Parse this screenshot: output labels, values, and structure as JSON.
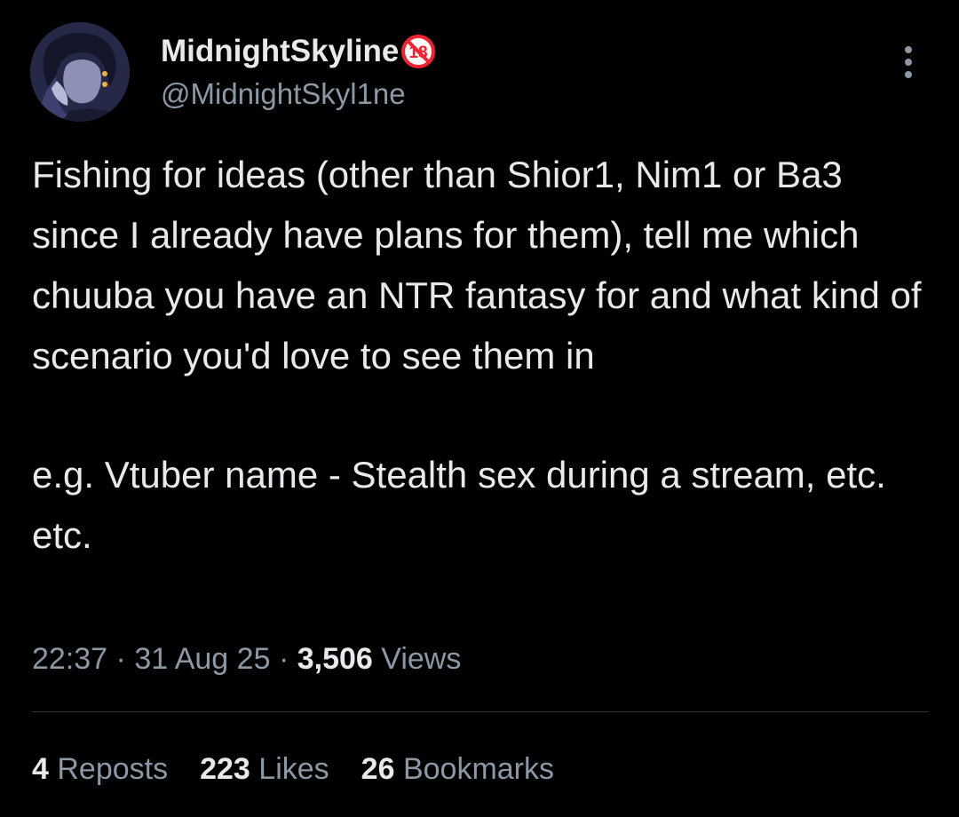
{
  "author": {
    "display_name": "MidnightSkyline",
    "handle": "@MidnightSkyl1ne",
    "badge_icon": "age-restricted-18-icon",
    "badge_text": "18"
  },
  "tweet": {
    "paragraph_1": "Fishing for ideas (other than Shior1, Nim1 or Ba3 since I already have plans for them), tell me which chuuba you have an NTR fantasy for and what kind of scenario you'd love to see them in",
    "paragraph_2": "e.g. Vtuber name - Stealth sex during a stream, etc. etc."
  },
  "meta": {
    "time": "22:37",
    "separator": "·",
    "date": "31 Aug 25",
    "views_count": "3,506",
    "views_label": "Views"
  },
  "stats": {
    "reposts_count": "4",
    "reposts_label": "Reposts",
    "likes_count": "223",
    "likes_label": "Likes",
    "bookmarks_count": "26",
    "bookmarks_label": "Bookmarks"
  },
  "colors": {
    "background": "#000000",
    "primary_text": "#e7e9ea",
    "secondary_text": "#8b98a5",
    "divider": "#2f3336",
    "badge_red": "#f4212e"
  }
}
